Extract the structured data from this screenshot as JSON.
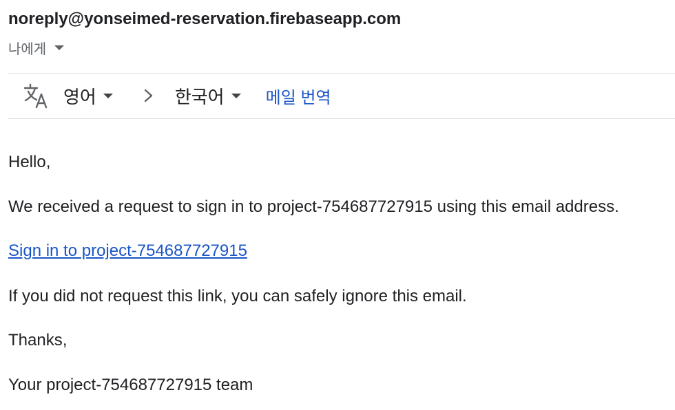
{
  "email": {
    "sender": "noreply@yonseimed-reservation.firebaseapp.com",
    "recipient_label": "나에게"
  },
  "translate_bar": {
    "icon": "translate-icon",
    "source_language": "영어",
    "target_language": "한국어",
    "translate_link": "메일 번역"
  },
  "body": {
    "greeting": "Hello,",
    "message": "We received a request to sign in to project-754687727915 using this email address.",
    "sign_in_link": "Sign in to project-754687727915",
    "ignore_note": "If you did not request this link, you can safely ignore this email.",
    "thanks": "Thanks,",
    "signature": "Your project-754687727915 team"
  },
  "colors": {
    "link": "#1a55c7",
    "text": "#202124",
    "muted": "#5f6368",
    "divider": "#e0e0e0"
  }
}
